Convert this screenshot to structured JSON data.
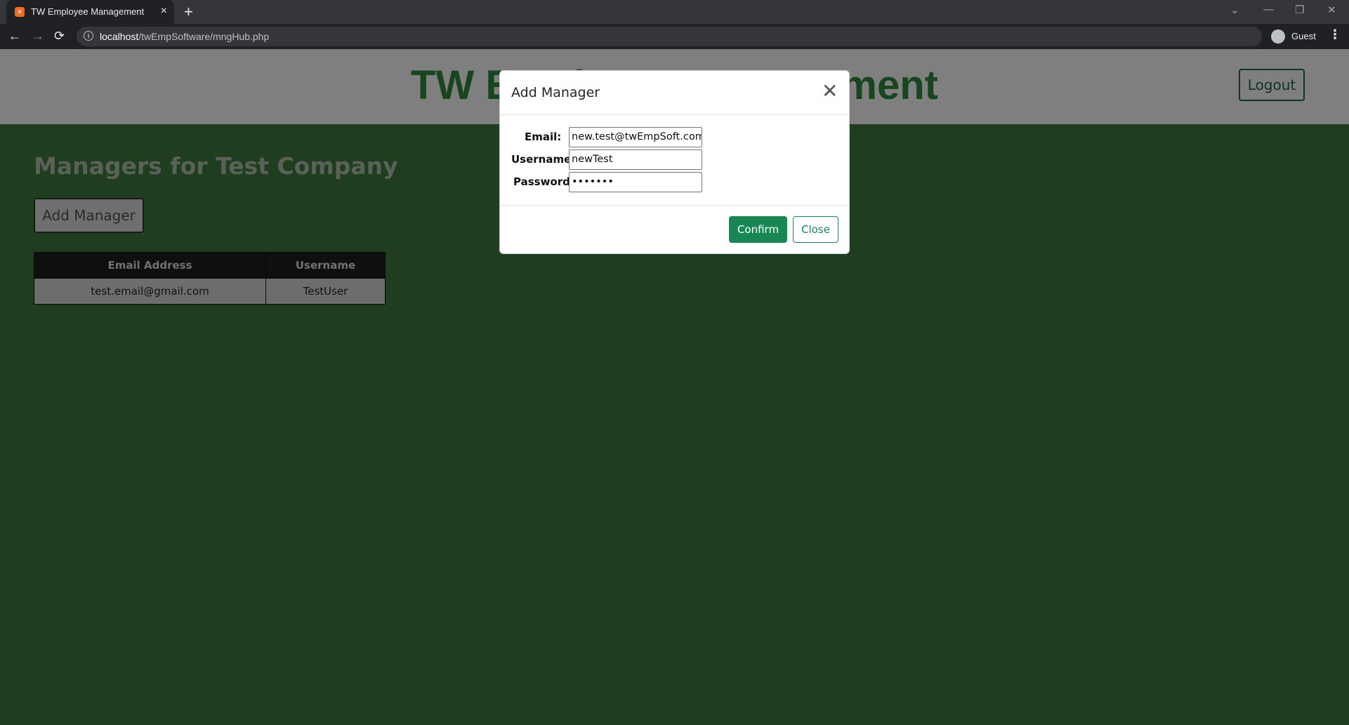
{
  "browser": {
    "tab_title": "TW Employee Management",
    "tab_close_icon": "close-icon",
    "new_tab_icon": "plus-icon",
    "url_host": "localhost",
    "url_path": "/twEmpSoftware/mngHub.php",
    "profile_label": "Guest",
    "nav": {
      "back": "←",
      "forward": "→",
      "reload": "⟳"
    }
  },
  "header": {
    "title": "TW Employee Management",
    "logout_label": "Logout"
  },
  "main": {
    "section_title": "Managers for Test Company",
    "add_manager_label": "Add Manager",
    "table": {
      "columns": [
        "Email Address",
        "Username"
      ],
      "rows": [
        [
          "test.email@gmail.com",
          "TestUser"
        ]
      ]
    }
  },
  "modal": {
    "title": "Add Manager",
    "close_symbol": "✕",
    "fields": {
      "email_label": "Email:",
      "email_value": "new.test@twEmpSoft.com",
      "username_label": "Username:",
      "username_value": "newTest",
      "password_label": "Password:",
      "password_value": "•••••••"
    },
    "confirm_label": "Confirm",
    "close_label": "Close"
  },
  "colors": {
    "accent": "#198754",
    "page_body": "#3f7d40",
    "title_green": "#2e8b3e"
  }
}
